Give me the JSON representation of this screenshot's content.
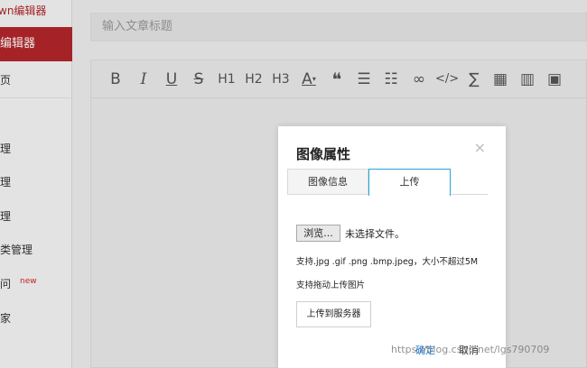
{
  "sidebar": {
    "brand": "wn编辑器",
    "active_item": "编辑器",
    "items": [
      {
        "label": "页"
      },
      {
        "label": "理"
      },
      {
        "label": "理"
      },
      {
        "label": "理"
      },
      {
        "label": "类管理"
      },
      {
        "label": "问",
        "badge": "new"
      },
      {
        "label": "家"
      }
    ]
  },
  "editor": {
    "title_placeholder": "输入文章标题",
    "toolbar": [
      {
        "icon": "bold-icon",
        "glyph": "B"
      },
      {
        "icon": "italic-icon",
        "glyph": "I"
      },
      {
        "icon": "underline-icon",
        "glyph": "U"
      },
      {
        "icon": "strikethrough-icon",
        "glyph": "S"
      },
      {
        "icon": "heading-1-icon",
        "glyph": "H1"
      },
      {
        "icon": "heading-2-icon",
        "glyph": "H2"
      },
      {
        "icon": "heading-3-icon",
        "glyph": "H3"
      },
      {
        "icon": "font-color-icon",
        "glyph": "A"
      },
      {
        "icon": "quote-icon",
        "glyph": "❝"
      },
      {
        "icon": "ordered-list-icon",
        "glyph": "☰"
      },
      {
        "icon": "unordered-list-icon",
        "glyph": "☷"
      },
      {
        "icon": "link-icon",
        "glyph": "∞"
      },
      {
        "icon": "code-icon",
        "glyph": "</>"
      },
      {
        "icon": "sigma-icon",
        "glyph": "∑"
      },
      {
        "icon": "table-icon",
        "glyph": "▦"
      },
      {
        "icon": "chart-icon",
        "glyph": "▥"
      },
      {
        "icon": "image-icon",
        "glyph": "▣"
      }
    ]
  },
  "modal": {
    "title": "图像属性",
    "close_glyph": "×",
    "tabs": [
      {
        "label": "图像信息",
        "active": false
      },
      {
        "label": "上传",
        "active": true
      }
    ],
    "browse_label": "浏览...",
    "no_file_text": "未选择文件。",
    "support_text": "支持.jpg .gif .png .bmp.jpeg，大小不超过5M",
    "drag_text": "支持拖动上传图片",
    "upload_button": "上传到服务器",
    "confirm": "确定",
    "cancel": "取消"
  },
  "watermark": "https://blog.csdn.net/lgs790709",
  "colors": {
    "brand_red": "#b3262a",
    "tab_active_border": "#27a6d8",
    "confirm_blue": "#2a7fd0"
  }
}
